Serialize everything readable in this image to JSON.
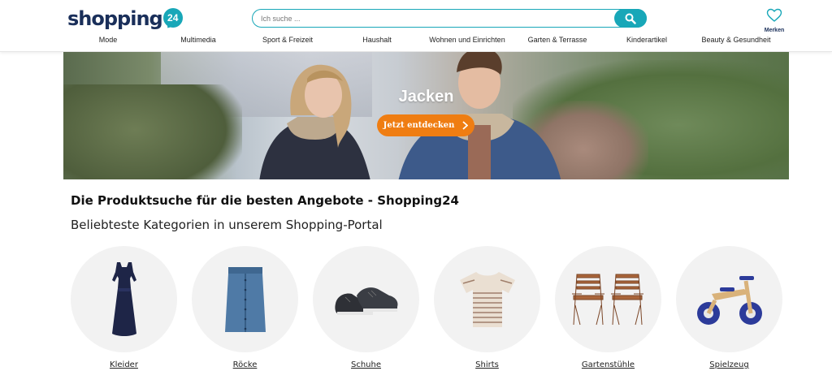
{
  "header": {
    "logo_text": "shopping",
    "logo_badge": "24",
    "search_placeholder": "Ich suche ...",
    "merken_label": "Merken"
  },
  "nav": [
    "Mode",
    "Multimedia",
    "Sport & Freizeit",
    "Haushalt",
    "Wohnen und Einrichten",
    "Garten & Terrasse",
    "Kinderartikel",
    "Beauty & Gesundheit"
  ],
  "banner": {
    "title": "Jacken",
    "cta_label": "Jetzt entdecken"
  },
  "main": {
    "heading": "Die Produktsuche für die besten Angebote - Shopping24",
    "subheading": "Beliebteste Kategorien in unserem Shopping-Portal"
  },
  "categories": [
    {
      "label": "Kleider",
      "icon": "dress-icon"
    },
    {
      "label": "Röcke",
      "icon": "skirt-icon"
    },
    {
      "label": "Schuhe",
      "icon": "sneaker-icon"
    },
    {
      "label": "Shirts",
      "icon": "shirt-icon"
    },
    {
      "label": "Gartenstühle",
      "icon": "garden-chair-icon"
    },
    {
      "label": "Spielzeug",
      "icon": "balance-bike-icon"
    }
  ],
  "colors": {
    "brand_navy": "#1a2f5a",
    "brand_teal": "#18a7b8",
    "cta_orange": "#ef7d12"
  }
}
